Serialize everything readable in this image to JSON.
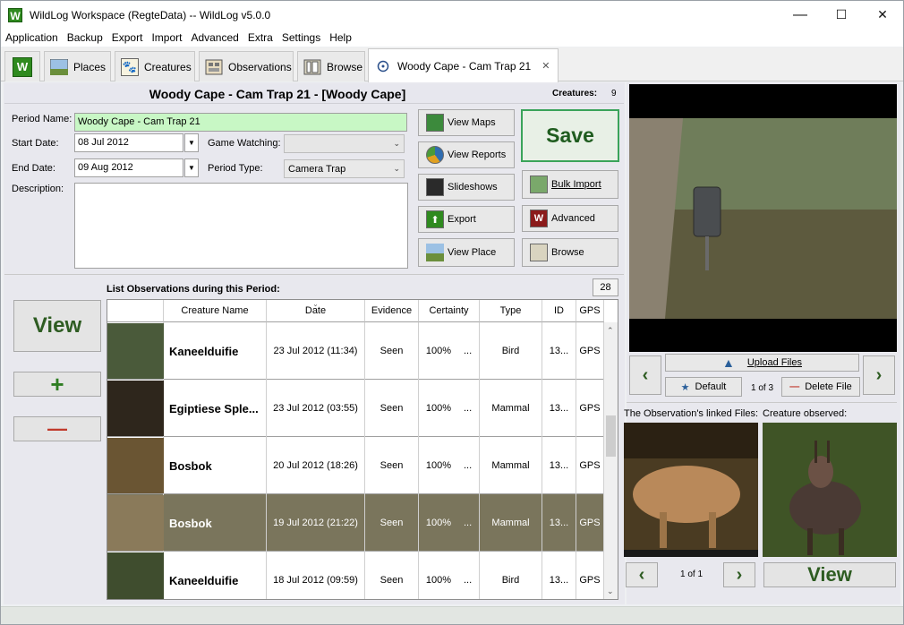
{
  "window": {
    "title": "WildLog Workspace (RegteData) -- WildLog v5.0.0",
    "app_icon_letter": "W",
    "minimize": "—",
    "maximize": "☐",
    "close": "✕"
  },
  "menu": [
    "Application",
    "Backup",
    "Export",
    "Import",
    "Advanced",
    "Extra",
    "Settings",
    "Help"
  ],
  "tabs": [
    {
      "label": "",
      "icon": "wildlog-home-icon"
    },
    {
      "label": "Places",
      "icon": "places-icon"
    },
    {
      "label": "Creatures",
      "icon": "paw-icon"
    },
    {
      "label": "Observations",
      "icon": "observations-icon"
    },
    {
      "label": "Browse",
      "icon": "browse-icon"
    },
    {
      "label": "Woody Cape - Cam Trap 21",
      "icon": "period-icon",
      "active": true,
      "close": "✕"
    }
  ],
  "header": {
    "title": "Woody Cape - Cam Trap 21 - [Woody Cape]",
    "creatures_label": "Creatures:",
    "creatures_count": "9"
  },
  "form": {
    "period_name_label": "Period Name:",
    "period_name": "Woody Cape - Cam Trap 21",
    "start_date_label": "Start Date:",
    "start_date": "08 Jul 2012",
    "end_date_label": "End Date:",
    "end_date": "09 Aug 2012",
    "game_watching_label": "Game Watching:",
    "game_watching": "",
    "period_type_label": "Period Type:",
    "period_type": "Camera Trap",
    "description_label": "Description:",
    "description": ""
  },
  "actions": {
    "view_maps": "View Maps",
    "view_reports": "View Reports",
    "slideshows": "Slideshows",
    "export": "Export",
    "view_place": "View Place",
    "save": "Save",
    "bulk_import": "Bulk Import",
    "advanced": "Advanced",
    "browse": "Browse"
  },
  "list": {
    "title": "List Observations during this Period:",
    "count": "28",
    "view_button": "View",
    "add_button": "+",
    "remove_button": "—",
    "columns": [
      "",
      "Creature Name",
      "Date",
      "Evidence",
      "Certainty",
      "Type",
      "ID",
      "GPS"
    ],
    "rows": [
      {
        "name": "Kaneelduifie",
        "date": "23 Jul 2012 (11:34)",
        "evidence": "Seen",
        "certainty": "100%",
        "certainty_more": "...",
        "type": "Bird",
        "id": "13...",
        "gps": "GPS",
        "selected": false
      },
      {
        "name": "Egiptiese Sple...",
        "date": "23 Jul 2012 (03:55)",
        "evidence": "Seen",
        "certainty": "100%",
        "certainty_more": "...",
        "type": "Mammal",
        "id": "13...",
        "gps": "GPS",
        "selected": false
      },
      {
        "name": "Bosbok",
        "date": "20 Jul 2012 (18:26)",
        "evidence": "Seen",
        "certainty": "100%",
        "certainty_more": "...",
        "type": "Mammal",
        "id": "13...",
        "gps": "GPS",
        "selected": false
      },
      {
        "name": "Bosbok",
        "date": "19 Jul 2012 (21:22)",
        "evidence": "Seen",
        "certainty": "100%",
        "certainty_more": "...",
        "type": "Mammal",
        "id": "13...",
        "gps": "GPS",
        "selected": true
      },
      {
        "name": "Kaneelduifie",
        "date": "18 Jul 2012 (09:59)",
        "evidence": "Seen",
        "certainty": "100%",
        "certainty_more": "...",
        "type": "Bird",
        "id": "13...",
        "gps": "GPS",
        "selected": false
      }
    ]
  },
  "period_files": {
    "upload_files": "Upload Files",
    "default": "Default",
    "page": "1 of 3",
    "delete_file": "Delete File"
  },
  "linked": {
    "observation_files_label": "The Observation's linked Files:",
    "creature_observed_label": "Creature observed:",
    "page": "1 of 1",
    "view": "View"
  },
  "colors": {
    "selected_row": "#7a755c",
    "accent_green": "#2e5c22",
    "period_name_bg": "#c8f7c5"
  }
}
